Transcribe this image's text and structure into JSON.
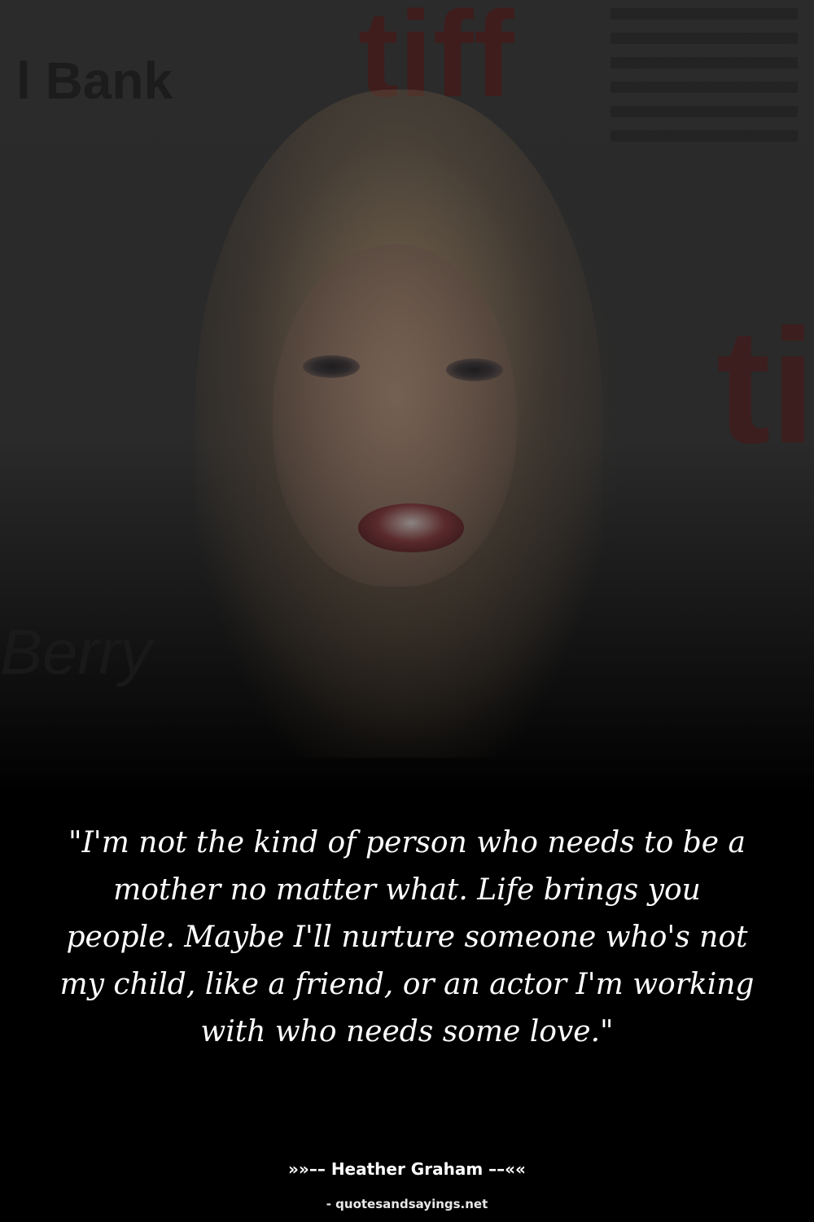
{
  "background_photo": {
    "backdrop_text_left_top": "l Bank",
    "backdrop_text_left_bottom": "Berry",
    "backdrop_logo_top": "tiff",
    "backdrop_logo_right": "ti"
  },
  "quote": {
    "text": "\"I'm not the kind of person who needs to be a mother no matter what. Life brings you people. Maybe I'll nurture someone who's not my child, like a friend, or an actor I'm working with who needs some love.\""
  },
  "attribution": {
    "author_line": "»»–– Heather Graham ––««"
  },
  "footer": {
    "source": "- quotesandsayings.net"
  },
  "colors": {
    "background": "#000000",
    "text": "#ffffff"
  }
}
